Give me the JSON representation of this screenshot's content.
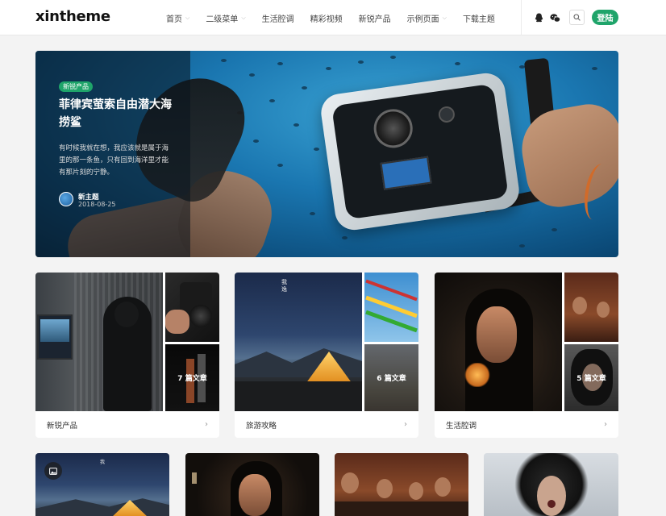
{
  "header": {
    "logo": "xintheme",
    "nav": [
      {
        "label": "首页",
        "has_dropdown": true
      },
      {
        "label": "二级菜单",
        "has_dropdown": true
      },
      {
        "label": "生活腔调",
        "has_dropdown": false
      },
      {
        "label": "精彩视频",
        "has_dropdown": false
      },
      {
        "label": "新锐产品",
        "has_dropdown": false
      },
      {
        "label": "示例页面",
        "has_dropdown": true
      },
      {
        "label": "下载主题",
        "has_dropdown": false
      }
    ],
    "icons": [
      "qq-icon",
      "wechat-icon",
      "search-icon"
    ],
    "login_label": "登陆"
  },
  "hero": {
    "badge": "新锐产品",
    "title": "菲律宾萤索自由潜大海捞鲨",
    "description": "有时候我就在想，我应该就是属于海里的那一条鱼，只有回到海洋里才能有那片刻的宁静。",
    "author": "新主题",
    "date": "2018-08-25"
  },
  "categories": [
    {
      "name": "新锐产品",
      "count_label": "7 篇文章"
    },
    {
      "name": "旅游攻略",
      "count_label": "6 篇文章"
    },
    {
      "name": "生活腔调",
      "count_label": "5 篇文章"
    }
  ],
  "colors": {
    "accent": "#1fa46a",
    "background": "#f3f3f3"
  }
}
